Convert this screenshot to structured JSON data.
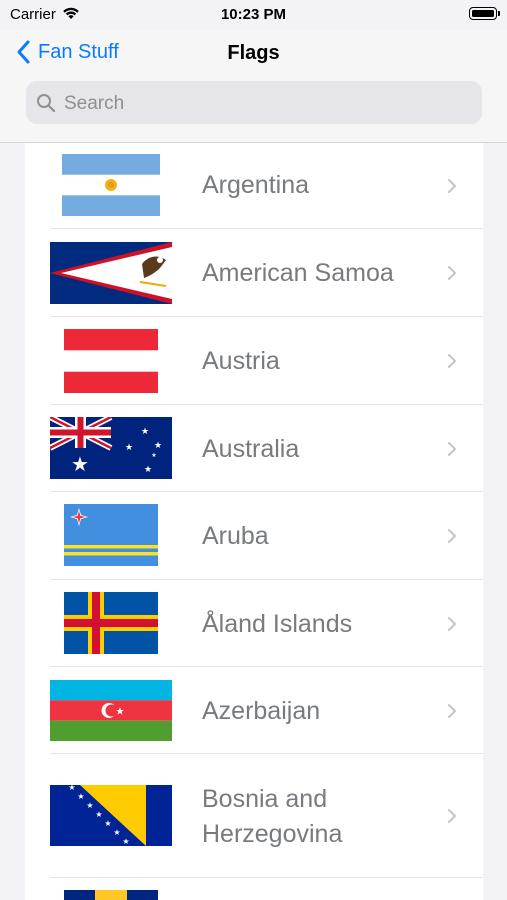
{
  "status_bar": {
    "carrier": "Carrier",
    "time": "10:23 PM"
  },
  "nav": {
    "back_label": "Fan Stuff",
    "title": "Flags"
  },
  "search": {
    "placeholder": "Search"
  },
  "countries": [
    {
      "name": "Argentina",
      "flag": "argentina-flag"
    },
    {
      "name": "American Samoa",
      "flag": "american-samoa-flag"
    },
    {
      "name": "Austria",
      "flag": "austria-flag"
    },
    {
      "name": "Australia",
      "flag": "australia-flag"
    },
    {
      "name": "Aruba",
      "flag": "aruba-flag"
    },
    {
      "name": "Åland Islands",
      "flag": "aland-islands-flag"
    },
    {
      "name": "Azerbaijan",
      "flag": "azerbaijan-flag"
    },
    {
      "name_line1": "Bosnia and",
      "name_line2": "Herzegovina",
      "flag": "bosnia-herzegovina-flag"
    },
    {
      "flag": "partial-flag"
    }
  ],
  "colors": {
    "accent": "#0a7aff",
    "background": "#f2f2f7",
    "label": "#777a7e"
  }
}
